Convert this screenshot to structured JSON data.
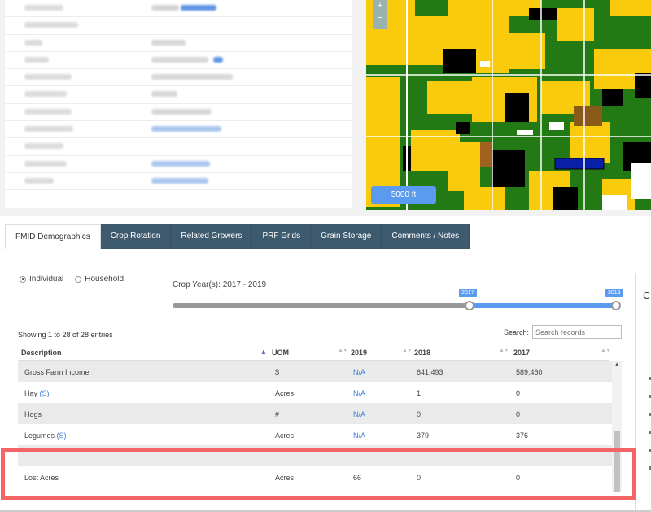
{
  "map": {
    "zoom_in": "+",
    "zoom_out": "−",
    "scale_label": "5000 ft",
    "colors": {
      "corn": "#f9cb0c",
      "soy": "#237a14",
      "fallow": "#000000",
      "road": "#ffffff",
      "selected": "#0a1fa8"
    }
  },
  "tabs": [
    "FMID Demographics",
    "Crop Rotation",
    "Related Growers",
    "PRF Grids",
    "Grain Storage",
    "Comments / Notes"
  ],
  "filters": {
    "individual_label": "Individual",
    "household_label": "Household",
    "year_label": "Crop Year(s): 2017 - 2019",
    "slider_start": "2017",
    "slider_end": "2019"
  },
  "table": {
    "showing_text": "Showing 1 to 28 of 28 entries",
    "search_label": "Search:",
    "search_placeholder": "Search records",
    "columns": [
      "Description",
      "UOM",
      "2019",
      "2018",
      "2017"
    ],
    "rows": [
      {
        "description": "Gross Farm Income",
        "suffix": "",
        "uom": "$",
        "y2019": "N/A",
        "y2018": "641,493",
        "y2017": "589,460"
      },
      {
        "description": "Hay",
        "suffix": "(S)",
        "uom": "Acres",
        "y2019": "N/A",
        "y2018": "1",
        "y2017": "0"
      },
      {
        "description": "Hogs",
        "suffix": "",
        "uom": "#",
        "y2019": "N/A",
        "y2018": "0",
        "y2017": "0"
      },
      {
        "description": "Legumes",
        "suffix": "(S)",
        "uom": "Acres",
        "y2019": "N/A",
        "y2018": "379",
        "y2017": "376"
      },
      {
        "description": "",
        "suffix": "",
        "uom": "",
        "y2019": "",
        "y2018": "",
        "y2017": ""
      },
      {
        "description": "Lost Acres",
        "suffix": "",
        "uom": "Acres",
        "y2019": "66",
        "y2018": "0",
        "y2017": "0"
      }
    ]
  },
  "side_panel_caption": "C",
  "highlight_color": "#f46464"
}
